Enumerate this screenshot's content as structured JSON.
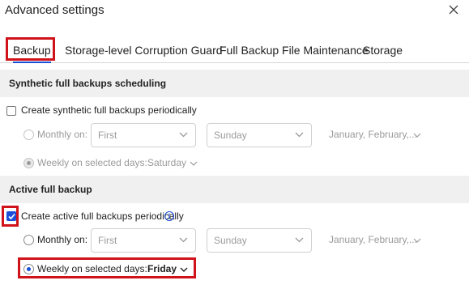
{
  "dialog": {
    "title": "Advanced settings"
  },
  "tabs": [
    {
      "label": "Backup",
      "active": true
    },
    {
      "label": "Storage-level Corruption Guard",
      "active": false
    },
    {
      "label": "Full Backup File Maintenance",
      "active": false
    },
    {
      "label": "Storage",
      "active": false
    }
  ],
  "synthetic": {
    "header": "Synthetic full backups scheduling",
    "checkbox_label": "Create synthetic full backups periodically",
    "checked": false,
    "monthly_label": "Monthly on:",
    "monthly_week": "First",
    "monthly_day": "Sunday",
    "monthly_months": "January, February,...",
    "weekly_label": "Weekly on selected days:",
    "weekly_day": "Saturday",
    "selected_option": "weekly",
    "enabled": false
  },
  "active": {
    "header": "Active full backup",
    "checkbox_label": "Create active full backups periodically",
    "checked": true,
    "monthly_label": "Monthly on:",
    "monthly_week": "First",
    "monthly_day": "Sunday",
    "monthly_months": "January, February,...",
    "weekly_label": "Weekly on selected days:",
    "weekly_day": "Friday",
    "selected_option": "weekly",
    "enabled": true
  },
  "colors": {
    "accent": "#1b4fd8",
    "highlight": "#d0121a",
    "section_bg": "#f0f0f0",
    "disabled_text": "#9a9a9a"
  },
  "icons": {
    "close": "close-icon",
    "chevron": "chevron-down-icon",
    "info": "info-icon"
  }
}
